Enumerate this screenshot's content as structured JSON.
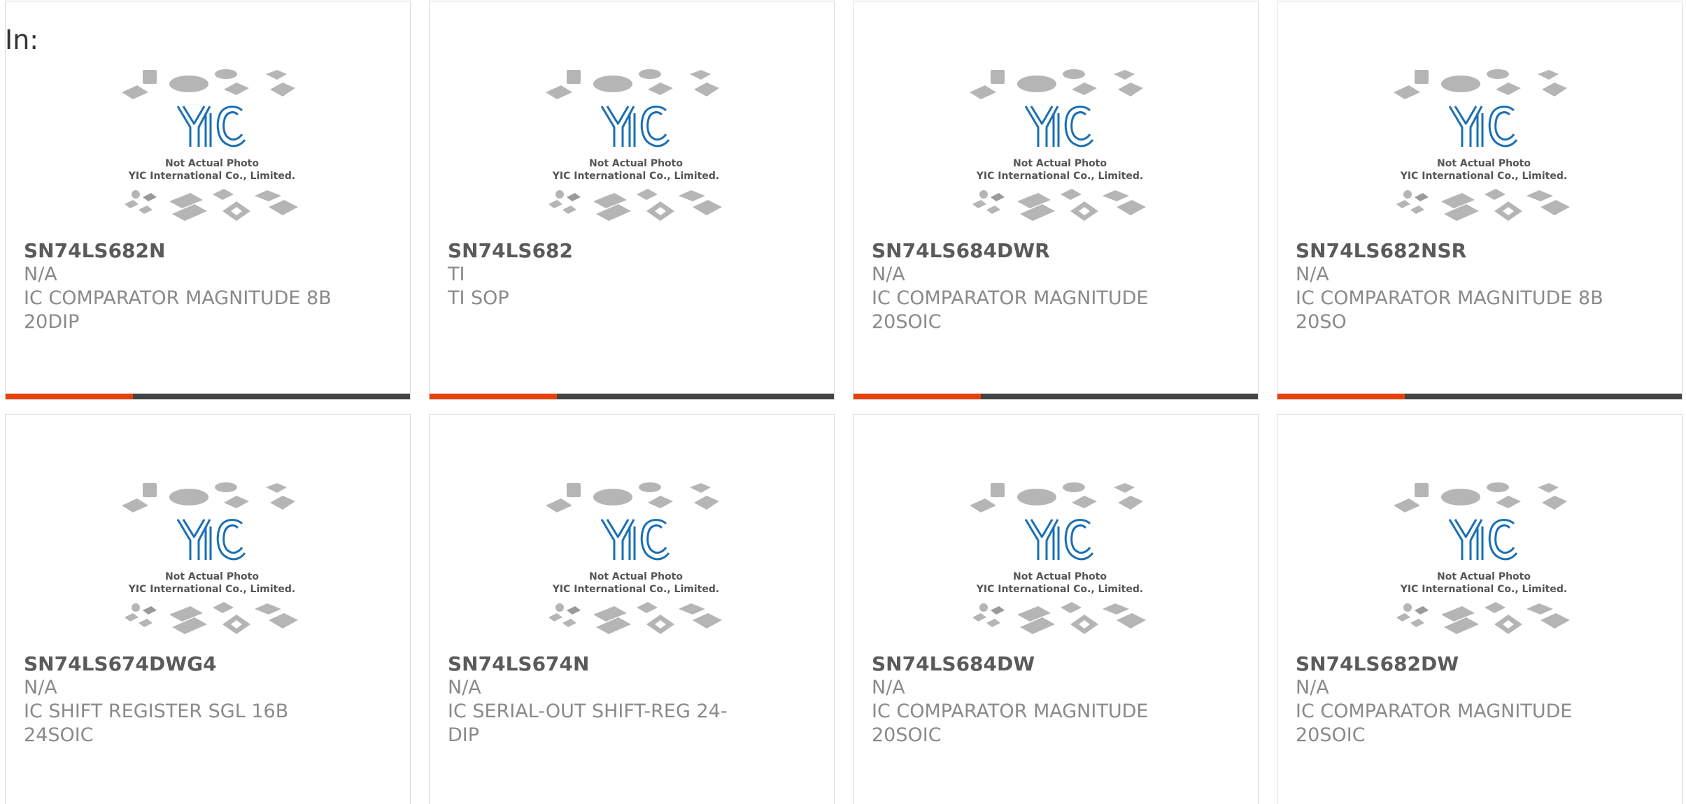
{
  "header": {
    "in_label": "In:"
  },
  "colors": {
    "accent": "#e8400c",
    "bar": "#444444",
    "logo_blue": "#1a6fb3"
  },
  "placeholder": {
    "logo_text": "YIC",
    "line1": "Not Actual Photo",
    "line2": "YIC International Co., Limited."
  },
  "products": [
    {
      "part_no": "SN74LS682N",
      "manufacturer": "N/A",
      "description": "IC COMPARATOR MAGNITUDE 8B 20DIP"
    },
    {
      "part_no": "SN74LS682",
      "manufacturer": "TI",
      "description": "TI SOP"
    },
    {
      "part_no": "SN74LS684DWR",
      "manufacturer": "N/A",
      "description": "IC COMPARATOR MAGNITUDE 20SOIC"
    },
    {
      "part_no": "SN74LS682NSR",
      "manufacturer": "N/A",
      "description": "IC COMPARATOR MAGNITUDE 8B 20SO"
    },
    {
      "part_no": "SN74LS674DWG4",
      "manufacturer": "N/A",
      "description": "IC SHIFT REGISTER SGL 16B 24SOIC"
    },
    {
      "part_no": "SN74LS674N",
      "manufacturer": "N/A",
      "description": "IC SERIAL-OUT SHIFT-REG 24-DIP"
    },
    {
      "part_no": "SN74LS684DW",
      "manufacturer": "N/A",
      "description": "IC COMPARATOR MAGNITUDE 20SOIC"
    },
    {
      "part_no": "SN74LS682DW",
      "manufacturer": "N/A",
      "description": "IC COMPARATOR MAGNITUDE 20SOIC"
    }
  ]
}
